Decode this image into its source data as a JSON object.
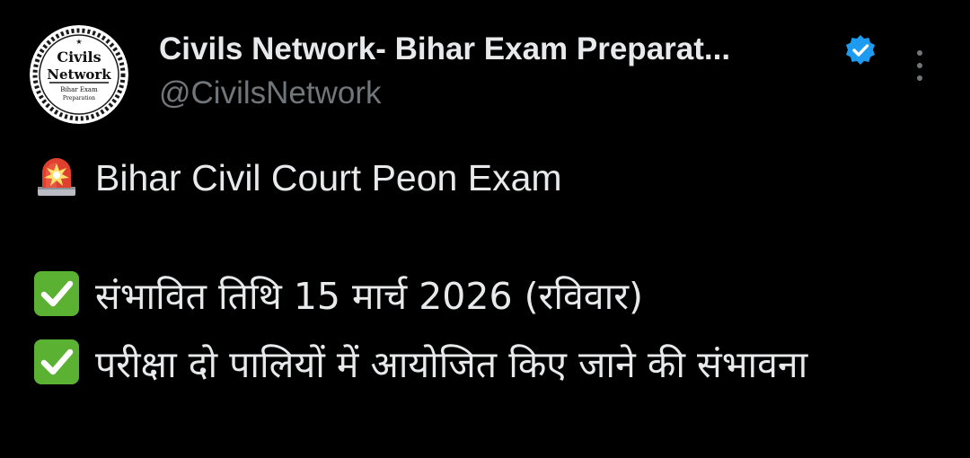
{
  "author": {
    "name": "Civils Network- Bihar Exam Preparat...",
    "handle": "@CivilsNetwork",
    "verified": true,
    "avatar_text": {
      "line1": "Civils",
      "line2": "Network",
      "line3": "Bihar Exam",
      "line4": "Preparation"
    }
  },
  "more_icon": "vertical-ellipsis-icon",
  "tweet": {
    "lines": [
      {
        "emoji": "police-car-light-icon",
        "text": "Bihar Civil Court Peon Exam"
      },
      {
        "emoji": "check-mark-button-icon",
        "text": "संभावित तिथि 15 मार्च 2026 (रविवार)"
      },
      {
        "emoji": "check-mark-button-icon",
        "text": "परीक्षा दो पालियों में आयोजित किए जाने की संभावना"
      }
    ]
  },
  "colors": {
    "background": "#000000",
    "primary_text": "#e7e9ea",
    "secondary_text": "#71767b",
    "verified_blue": "#1d9bf0",
    "check_green": "#5bb131",
    "siren_red": "#e0412f"
  }
}
